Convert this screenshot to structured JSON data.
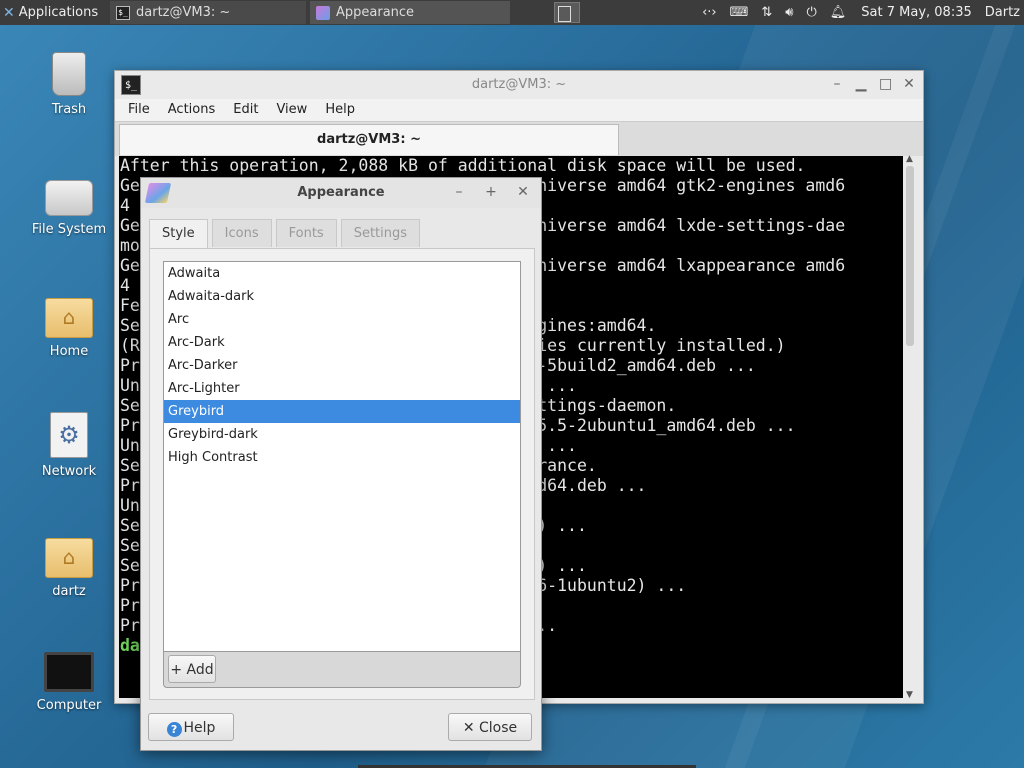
{
  "panel": {
    "applications_label": "Applications",
    "tasks": [
      {
        "label": "dartz@VM3: ~"
      },
      {
        "label": "Appearance"
      }
    ],
    "clock": "Sat  7 May, 08:35",
    "user": "Dartz"
  },
  "desktop_icons": [
    {
      "label": "Trash"
    },
    {
      "label": "File System"
    },
    {
      "label": "Home"
    },
    {
      "label": "Network"
    },
    {
      "label": "dartz"
    },
    {
      "label": "Computer"
    }
  ],
  "terminal": {
    "title": "dartz@VM3: ~",
    "menu": [
      "File",
      "Actions",
      "Edit",
      "View",
      "Help"
    ],
    "tab_label": "dartz@VM3: ~",
    "lines": [
      "After this operation, 2,088 kB of additional disk space will be used.",
      "Ge                                   ish/universe amd64 gtk2-engines amd6",
      "4",
      "Ge                                   ish/universe amd64 lxde-settings-dae",
      "mo",
      "Ge                                   ish/universe amd64 lxappearance amd6",
      "4",
      "Fe",
      "Se                                   k2-engines:amd64.",
      "(R                                   ectories currently installed.)",
      "Pr                                   .20.2-5build2_amd64.deb ...",
      "Un                                   ild2) ...",
      "Se                                   de-settings-daemon.",
      "Pr                                   on_0.5.5-2ubuntu1_amd64.deb ...",
      "Un                                   ntu1) ...",
      "Se                                   appearance.",
      "Pr                                   -1_amd64.deb ...",
      "Un",
      "Se                                   untu1) ...",
      "Se",
      "Se                                   uild2) ...",
      "Pr                                    (0.26-1ubuntu2) ...",
      "Pr                                   ..",
      "Pr                                   u1) ..."
    ],
    "prompt_fragment": "da"
  },
  "appearance": {
    "title": "Appearance",
    "tabs": [
      "Style",
      "Icons",
      "Fonts",
      "Settings"
    ],
    "themes": [
      "Adwaita",
      "Adwaita-dark",
      "Arc",
      "Arc-Dark",
      "Arc-Darker",
      "Arc-Lighter",
      "Greybird",
      "Greybird-dark",
      "High Contrast"
    ],
    "selected_theme": "Greybird",
    "add_label": "Add",
    "help_label": "Help",
    "close_label": "Close"
  }
}
